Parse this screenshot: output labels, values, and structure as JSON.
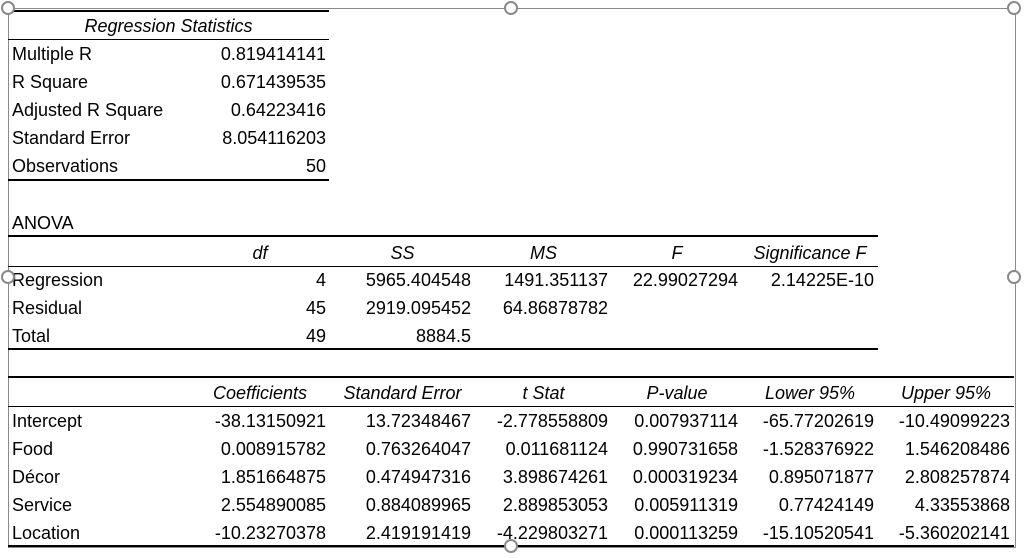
{
  "regression_statistics": {
    "title": "Regression Statistics",
    "rows": [
      {
        "label": "Multiple R",
        "value": "0.819414141"
      },
      {
        "label": "R Square",
        "value": "0.671439535"
      },
      {
        "label": "Adjusted R Square",
        "value": "0.64223416"
      },
      {
        "label": "Standard Error",
        "value": "8.054116203"
      },
      {
        "label": "Observations",
        "value": "50"
      }
    ]
  },
  "anova": {
    "title": "ANOVA",
    "headers": [
      "df",
      "SS",
      "MS",
      "F",
      "Significance F"
    ],
    "rows": [
      {
        "label": "Regression",
        "df": "4",
        "ss": "5965.404548",
        "ms": "1491.351137",
        "f": "22.99027294",
        "sig_f": "2.14225E-10"
      },
      {
        "label": "Residual",
        "df": "45",
        "ss": "2919.095452",
        "ms": "64.86878782",
        "f": "",
        "sig_f": ""
      },
      {
        "label": "Total",
        "df": "49",
        "ss": "8884.5",
        "ms": "",
        "f": "",
        "sig_f": ""
      }
    ]
  },
  "coefficients": {
    "headers": [
      "Coefficients",
      "Standard Error",
      "t Stat",
      "P-value",
      "Lower 95%",
      "Upper 95%"
    ],
    "rows": [
      {
        "label": "Intercept",
        "coef": "-38.13150921",
        "se": "13.72348467",
        "t": "-2.778558809",
        "p": "0.007937114",
        "lower": "-65.77202619",
        "upper": "-10.49099223"
      },
      {
        "label": "Food",
        "coef": "0.008915782",
        "se": "0.763264047",
        "t": "0.011681124",
        "p": "0.990731658",
        "lower": "-1.528376922",
        "upper": "1.546208486"
      },
      {
        "label": "Décor",
        "coef": "1.851664875",
        "se": "0.474947316",
        "t": "3.898674261",
        "p": "0.000319234",
        "lower": "0.895071877",
        "upper": "2.808257874"
      },
      {
        "label": "Service",
        "coef": "2.554890085",
        "se": "0.884089965",
        "t": "2.889853053",
        "p": "0.005911319",
        "lower": "0.77424149",
        "upper": "4.33553868"
      },
      {
        "label": "Location",
        "coef": "-10.23270378",
        "se": "2.419191419",
        "t": "-4.229803271",
        "p": "0.000113259",
        "lower": "-15.10520541",
        "upper": "-5.360202141"
      }
    ]
  },
  "ui": {
    "selection_frame_color": "#8a8a8a",
    "resize_handles": [
      "top-left",
      "top-center",
      "top-right",
      "middle-left",
      "middle-right",
      "bottom-center"
    ]
  }
}
